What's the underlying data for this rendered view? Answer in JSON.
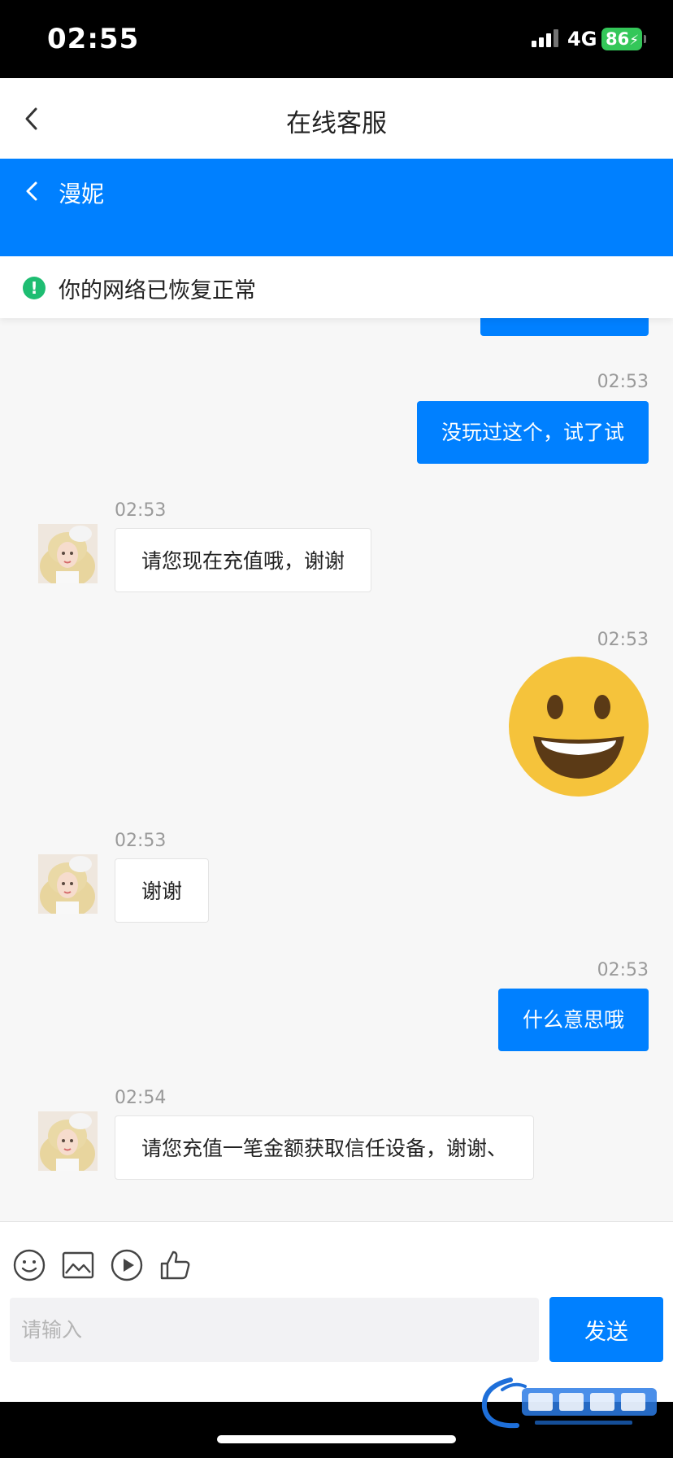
{
  "status_bar": {
    "time": "02:55",
    "network": "4G",
    "battery": "86"
  },
  "nav": {
    "title": "在线客服"
  },
  "agent_header": {
    "name": "漫妮"
  },
  "notice": {
    "text": "你的网络已恢复正常",
    "color": "#1ebd72"
  },
  "messages": [
    {
      "side": "out",
      "time": "02:53",
      "text": "没玩过这个，试了试"
    },
    {
      "side": "in",
      "time": "02:53",
      "text": "请您现在充值哦，谢谢"
    },
    {
      "side": "out",
      "time": "02:53",
      "emoji": "grinning-face-emoji"
    },
    {
      "side": "in",
      "time": "02:53",
      "text": "谢谢"
    },
    {
      "side": "out",
      "time": "02:53",
      "text": "什么意思哦"
    },
    {
      "side": "in",
      "time": "02:54",
      "text": "请您充值一笔金额获取信任设备，谢谢、"
    }
  ],
  "toolbar": {
    "icons": [
      "smiley-icon",
      "image-icon",
      "play-icon",
      "thumbs-up-icon"
    ]
  },
  "composer": {
    "placeholder": "请输入",
    "send_label": "发送"
  },
  "colors": {
    "accent": "#0080ff",
    "chat_bg": "#f7f7f7",
    "battery": "#34c759"
  }
}
